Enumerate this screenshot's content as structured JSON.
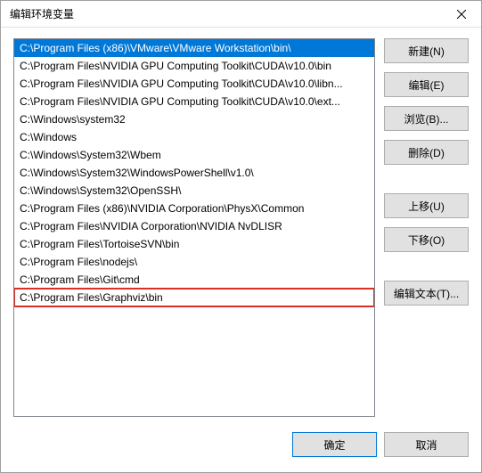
{
  "window": {
    "title": "编辑环境变量"
  },
  "list": {
    "items": [
      {
        "text": "C:\\Program Files (x86)\\VMware\\VMware Workstation\\bin\\",
        "selected": true,
        "highlighted": false
      },
      {
        "text": "C:\\Program Files\\NVIDIA GPU Computing Toolkit\\CUDA\\v10.0\\bin",
        "selected": false,
        "highlighted": false
      },
      {
        "text": "C:\\Program Files\\NVIDIA GPU Computing Toolkit\\CUDA\\v10.0\\libn...",
        "selected": false,
        "highlighted": false
      },
      {
        "text": "C:\\Program Files\\NVIDIA GPU Computing Toolkit\\CUDA\\v10.0\\ext...",
        "selected": false,
        "highlighted": false
      },
      {
        "text": "C:\\Windows\\system32",
        "selected": false,
        "highlighted": false
      },
      {
        "text": "C:\\Windows",
        "selected": false,
        "highlighted": false
      },
      {
        "text": "C:\\Windows\\System32\\Wbem",
        "selected": false,
        "highlighted": false
      },
      {
        "text": "C:\\Windows\\System32\\WindowsPowerShell\\v1.0\\",
        "selected": false,
        "highlighted": false
      },
      {
        "text": "C:\\Windows\\System32\\OpenSSH\\",
        "selected": false,
        "highlighted": false
      },
      {
        "text": "C:\\Program Files (x86)\\NVIDIA Corporation\\PhysX\\Common",
        "selected": false,
        "highlighted": false
      },
      {
        "text": "C:\\Program Files\\NVIDIA Corporation\\NVIDIA NvDLISR",
        "selected": false,
        "highlighted": false
      },
      {
        "text": "C:\\Program Files\\TortoiseSVN\\bin",
        "selected": false,
        "highlighted": false
      },
      {
        "text": "C:\\Program Files\\nodejs\\",
        "selected": false,
        "highlighted": false
      },
      {
        "text": "C:\\Program Files\\Git\\cmd",
        "selected": false,
        "highlighted": false
      },
      {
        "text": "C:\\Program Files\\Graphviz\\bin",
        "selected": false,
        "highlighted": true
      }
    ]
  },
  "buttons": {
    "new": "新建(N)",
    "edit": "编辑(E)",
    "browse": "浏览(B)...",
    "delete": "删除(D)",
    "moveup": "上移(U)",
    "movedown": "下移(O)",
    "edittext": "编辑文本(T)..."
  },
  "footer": {
    "ok": "确定",
    "cancel": "取消"
  }
}
